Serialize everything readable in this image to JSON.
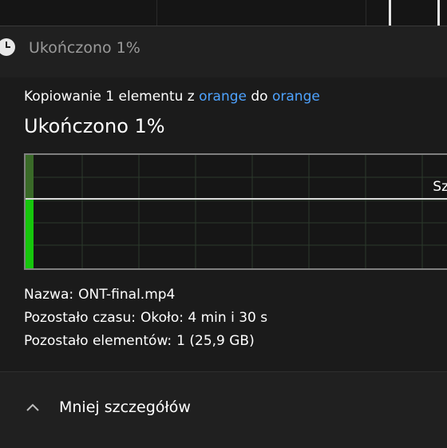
{
  "dialog": {
    "title": "Ukończono 1%",
    "icon": "clock-icon"
  },
  "copy": {
    "prefix": "Kopiowanie 1 elementu z",
    "source": "orange",
    "middle": "do",
    "destination": "orange",
    "heading": "Ukończono 1%",
    "progress_percent": 1
  },
  "graph": {
    "speed_label": "Sz",
    "fill_color": "#16c60c",
    "line_color": "#d9d9d9"
  },
  "details": {
    "name_label": "Nazwa:",
    "name_value": "ONT-final.mp4",
    "time_label": "Pozostało czasu:",
    "time_value": "Około: 4 min i 30 s",
    "items_label": "Pozostało elementów:",
    "items_value": "1 (25,9 GB)"
  },
  "footer": {
    "toggle_label": "Mniej szczegółów",
    "toggle_icon": "chevron-up-icon"
  }
}
